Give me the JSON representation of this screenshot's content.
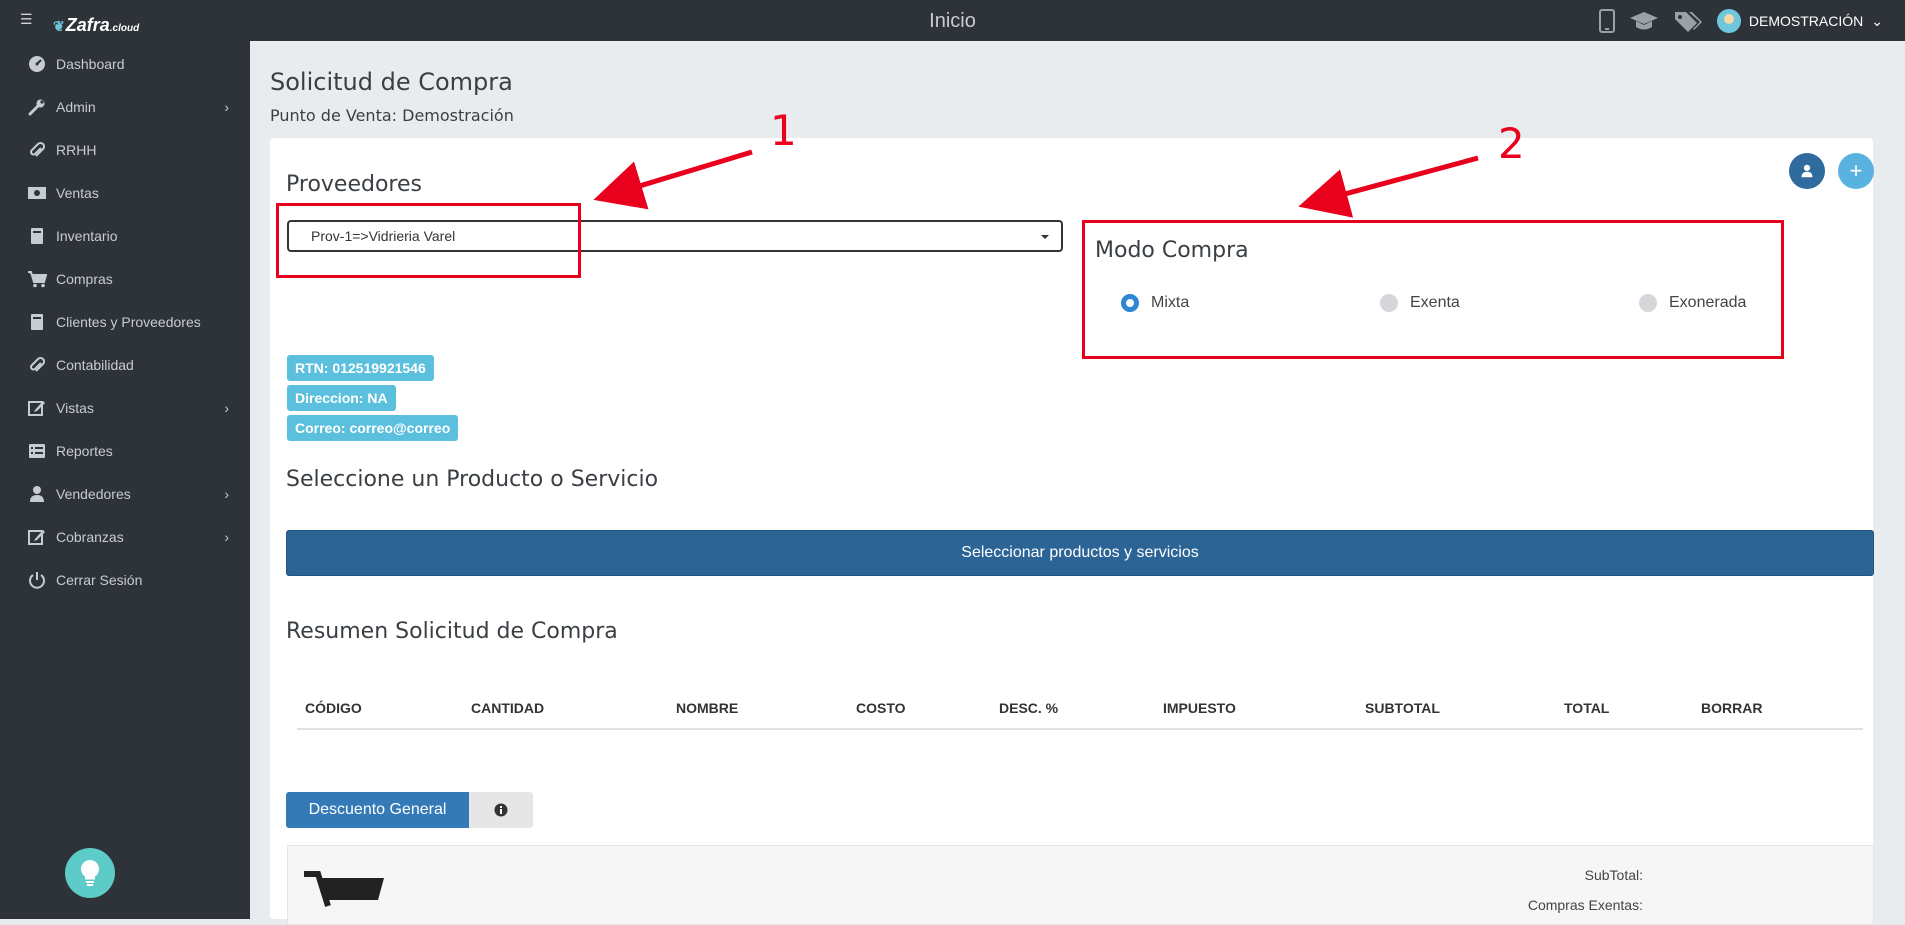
{
  "app": {
    "logo": "Zafra",
    "logo_suffix": ".cloud",
    "top_title": "Inicio",
    "user_name": "DEMOSTRACIÓN"
  },
  "sidebar": {
    "items": [
      {
        "label": "Dashboard",
        "icon": "dashboard-icon",
        "submenu": false
      },
      {
        "label": "Admin",
        "icon": "wrench-icon",
        "submenu": true
      },
      {
        "label": "RRHH",
        "icon": "paperclip-icon",
        "submenu": false
      },
      {
        "label": "Ventas",
        "icon": "money-icon",
        "submenu": false
      },
      {
        "label": "Inventario",
        "icon": "book-icon",
        "submenu": false
      },
      {
        "label": "Compras",
        "icon": "cart-icon",
        "submenu": false
      },
      {
        "label": "Clientes y Proveedores",
        "icon": "book-icon",
        "submenu": false
      },
      {
        "label": "Contabilidad",
        "icon": "paperclip-icon",
        "submenu": false
      },
      {
        "label": "Vistas",
        "icon": "edit-icon",
        "submenu": true
      },
      {
        "label": "Reportes",
        "icon": "list-icon",
        "submenu": false
      },
      {
        "label": "Vendedores",
        "icon": "user-icon",
        "submenu": true
      },
      {
        "label": "Cobranzas",
        "icon": "edit-icon",
        "submenu": true
      },
      {
        "label": "Cerrar Sesión",
        "icon": "power-icon",
        "submenu": false
      }
    ]
  },
  "page": {
    "title": "Solicitud de Compra",
    "subtitle": "Punto de Venta: Demostración"
  },
  "proveedores": {
    "heading": "Proveedores",
    "selected": "Prov-1=>Vidrieria Varel"
  },
  "modo_compra": {
    "heading": "Modo Compra",
    "options": [
      "Mixta",
      "Exenta",
      "Exonerada"
    ],
    "selected": "Mixta"
  },
  "provider_info": {
    "rtn": "RTN: 012519921546",
    "direccion": "Direccion: NA",
    "correo": "Correo: correo@correo"
  },
  "productos": {
    "heading": "Seleccione un Producto o Servicio",
    "button": "Seleccionar productos y servicios"
  },
  "resumen": {
    "heading": "Resumen Solicitud de Compra",
    "columns": [
      "CÓDIGO",
      "CANTIDAD",
      "NOMBRE",
      "COSTO",
      "DESC. %",
      "IMPUESTO",
      "SUBTOTAL",
      "TOTAL",
      "BORRAR"
    ]
  },
  "descuento": {
    "button": "Descuento General"
  },
  "summary": {
    "subtotal_label": "SubTotal:",
    "compras_exentas_label": "Compras Exentas:"
  },
  "annotations": {
    "one": "1",
    "two": "2"
  },
  "colors": {
    "sidebar": "#2d3339",
    "primary": "#2d6496",
    "badge": "#5bc0de",
    "annotation": "#e8001c"
  }
}
